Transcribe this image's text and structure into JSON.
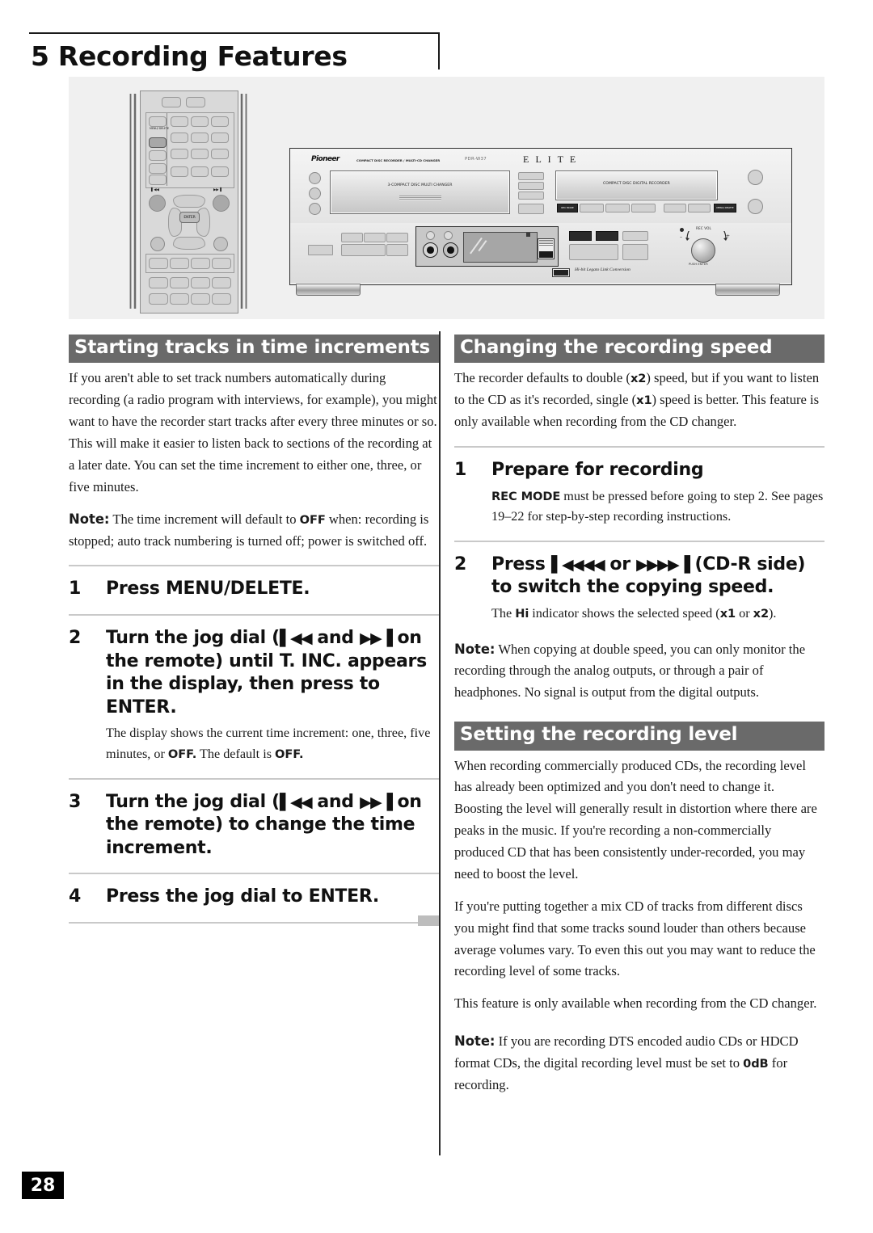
{
  "chapter": {
    "number": "5",
    "title": "5 Recording Features"
  },
  "illustration": {
    "remote": {
      "menu_delete_label": "MENU/ DELETE",
      "enter_label": "ENTER",
      "prev_icon": "◀◀",
      "next_icon": "▶▶",
      "skip_back_label": "▌◀◀",
      "skip_fwd_label": "▶▶▐"
    },
    "deck": {
      "brand": "Pioneer",
      "brand_sub": "COMPACT DISC RECORDER / MULTI-CD CHANGER",
      "model": "PDR-W37",
      "elite": "E L I T E",
      "changer_tray": "3-COMPACT DISC MULTI CHANGER",
      "recorder_tray": "COMPACT DISC DIGITAL RECORDER",
      "rec_mode_button": "REC MODE",
      "menu_delete_button": "MENU/ DELETE",
      "rec_vol_label": "REC VOL",
      "push_enter_label": "PUSH ENTER",
      "minus": "–",
      "plus": "+",
      "legato": "Hi-bit Legato Link Conversion",
      "hdcd_label": "HDCD"
    }
  },
  "left_column": {
    "section": {
      "title": "Starting tracks in time increments",
      "intro": "If you aren't able to set track numbers automatically during recording (a radio program with interviews, for example), you might want to have the recorder start tracks after every three minutes or so. This will make it easier to listen back to sections of the recording at a later date. You can set the time increment to either one, three, or five minutes.",
      "note_label": "Note:",
      "note_part1": " The time increment will default to ",
      "note_bold": "OFF",
      "note_part2": " when: recording is stopped; auto track numbering is turned off; power is switched off."
    },
    "steps": [
      {
        "num": "1",
        "title": "Press MENU/DELETE.",
        "sub": ""
      },
      {
        "num": "2",
        "title_a": "Turn the jog dial (",
        "arrows_a": "▌◀◀",
        "title_b": " and ",
        "arrows_b": "▶▶▐",
        "title_c": " on the remote) until T. INC. appears in the display, then press to ENTER.",
        "sub_a": "The display shows the current time increment: one, three, five minutes, or ",
        "sub_bold1": "OFF.",
        "sub_b": " The default is ",
        "sub_bold2": "OFF."
      },
      {
        "num": "3",
        "title_a": "Turn the jog dial (",
        "arrows_a": "▌◀◀",
        "title_b": " and ",
        "arrows_b": "▶▶▐",
        "title_c": " on the remote) to change the time increment.",
        "sub": ""
      },
      {
        "num": "4",
        "title": "Press the jog dial to ENTER.",
        "sub": ""
      }
    ]
  },
  "right_column": {
    "speed_section": {
      "title": "Changing the recording speed",
      "intro_a": "The recorder defaults to double (",
      "intro_x2": "x2",
      "intro_b": ") speed, but if you want to listen to the CD as it's recorded, single (",
      "intro_x1": "x1",
      "intro_c": ") speed is better. This feature is only available when recording from the CD changer."
    },
    "speed_steps": [
      {
        "num": "1",
        "title": "Prepare for recording",
        "sub_bold": "REC MODE",
        "sub_text": " must be pressed before going to step 2. See pages 19–22 for step-by-step recording instructions."
      },
      {
        "num": "2",
        "title_a": "Press ",
        "arrows_a": "▌◀◀◀◀",
        "title_b": " or ",
        "arrows_b": "▶▶▶▶▐",
        "title_c": " (CD-R side) to switch the copying speed.",
        "sub_a": "The ",
        "sub_hi": "Hi",
        "sub_b": " indicator shows the selected speed (",
        "sub_x1": "x1",
        "sub_c": " or ",
        "sub_x2": "x2",
        "sub_d": ")."
      }
    ],
    "speed_note": {
      "label": "Note:",
      "text": " When copying at double speed, you can only monitor the recording through the analog outputs, or through a pair of headphones. No signal is output from the digital outputs."
    },
    "level_section": {
      "title": "Setting the recording level",
      "para1": "When recording commercially produced CDs, the recording level has already been optimized and you don't need to change it. Boosting the level will generally result in distortion where there are peaks in the music. If you're recording a non-commercially produced CD that has been consistently under-recorded, you may need to boost the level.",
      "para2": "If you're putting together a mix CD of tracks from different discs you might find that some tracks sound louder than others because  average volumes vary. To even this out you may want to reduce the recording level of some tracks.",
      "para3": "This feature is only available when recording from the CD changer.",
      "note_label": "Note:",
      "note_a": " If you are recording DTS encoded audio CDs or HDCD format CDs, the digital recording level must be set to ",
      "note_bold": "0dB",
      "note_b": " for recording."
    }
  },
  "footer": {
    "page_number": "28"
  },
  "colors": {
    "header_bar": "#6a6a6a",
    "rule": "#c9c9c9",
    "panel_bg": "#f0f0f0",
    "page_num_bg": "#000000"
  }
}
